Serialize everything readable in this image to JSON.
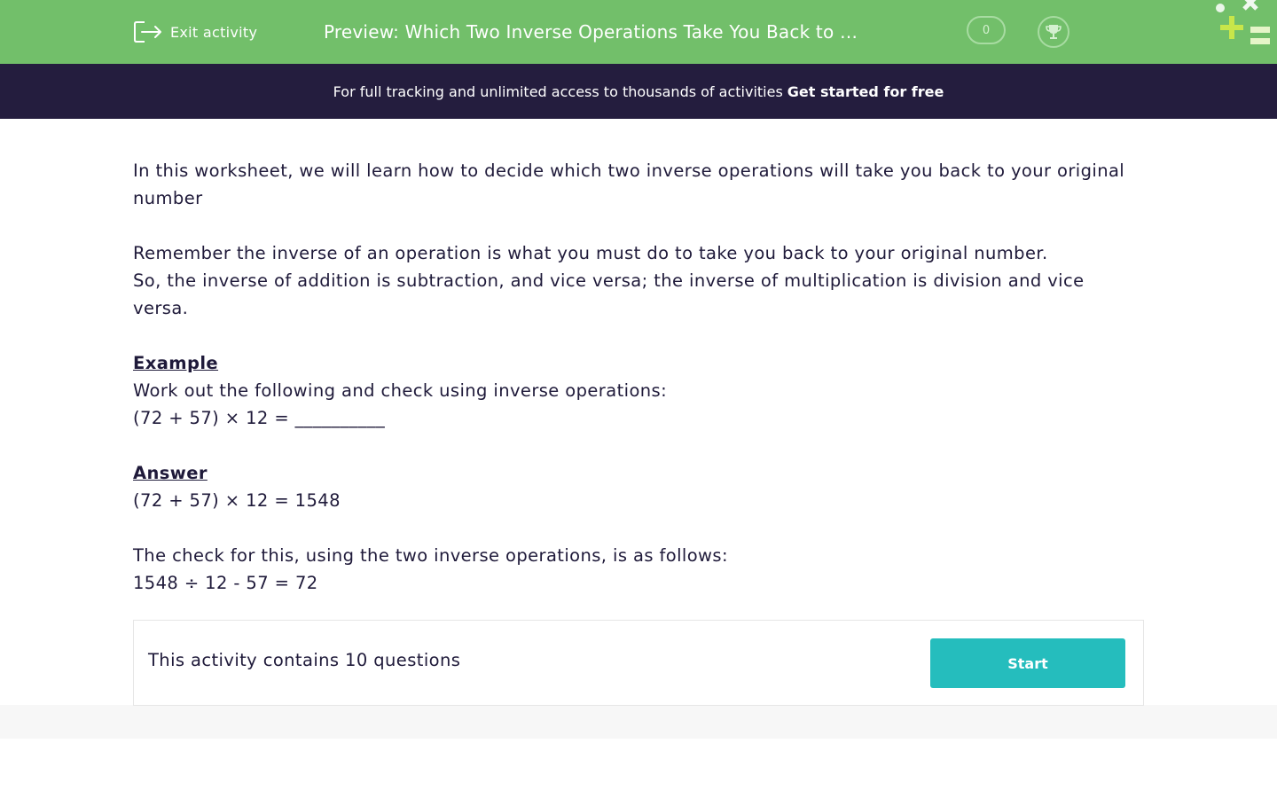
{
  "header": {
    "exit_label": "Exit activity",
    "title": "Preview: Which Two Inverse Operations Take You Back to …",
    "score": "0",
    "exit_icon": "exit-icon",
    "trophy_icon": "trophy-icon",
    "logo_icon": "plus-minus-logo-icon"
  },
  "promo": {
    "text": "For full tracking and unlimited access to thousands of activities",
    "cta": "Get started for free"
  },
  "intro": {
    "line1": "In this worksheet, we will learn how to decide which two inverse operations will take you back to your original number",
    "line2": "Remember the inverse of an operation is what you must do to take you back to your original number.",
    "line3": "So, the inverse of addition is subtraction, and vice versa; the inverse of multiplication is division and vice versa."
  },
  "example": {
    "heading": "Example",
    "instruction": "Work out the following and check using inverse operations:",
    "problem": "(72 + 57) × 12 = __________"
  },
  "answer": {
    "heading": "Answer",
    "result": "(72 + 57) × 12 = 1548",
    "check_intro": "The check for this, using the two inverse operations, is as follows:",
    "check": "1548 ÷ 12 - 57 = 72"
  },
  "activity": {
    "summary": "This activity contains 10 questions",
    "start_label": "Start"
  },
  "colors": {
    "header_bg": "#72bf6a",
    "promo_bg": "#241d3e",
    "start_bg": "#25bdbd",
    "text": "#1f1a3a"
  }
}
